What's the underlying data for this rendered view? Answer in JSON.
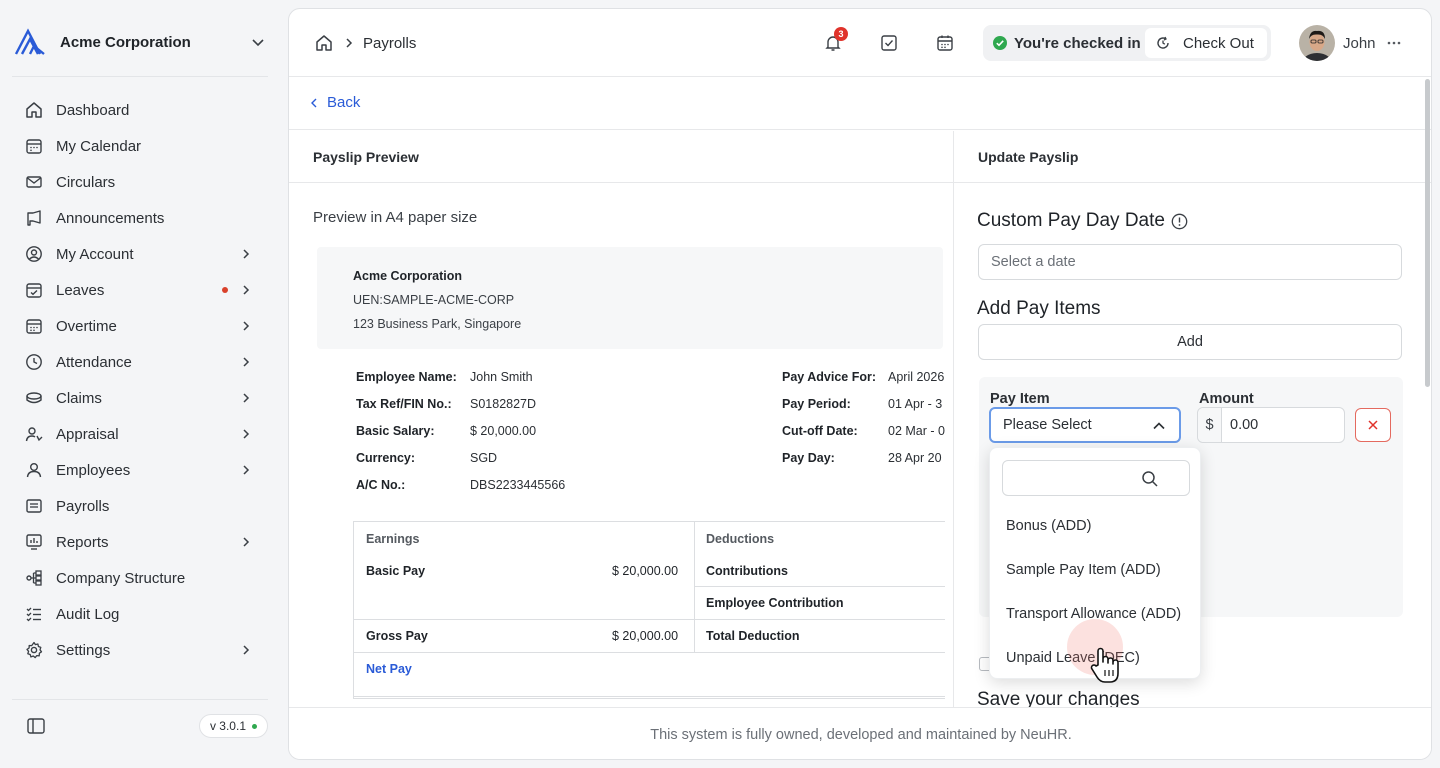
{
  "org": {
    "name": "Acme Corporation"
  },
  "nav": [
    {
      "label": "Dashboard",
      "icon": "home-icon",
      "chevron": false
    },
    {
      "label": "My Calendar",
      "icon": "calendar-icon",
      "chevron": false
    },
    {
      "label": "Circulars",
      "icon": "mail-icon",
      "chevron": false
    },
    {
      "label": "Announcements",
      "icon": "megaphone-icon",
      "chevron": false
    },
    {
      "label": "My Account",
      "icon": "user-circle-icon",
      "chevron": true
    },
    {
      "label": "Leaves",
      "icon": "calendar-check-icon",
      "chevron": true,
      "dot": true
    },
    {
      "label": "Overtime",
      "icon": "calendar-clock-icon",
      "chevron": true
    },
    {
      "label": "Attendance",
      "icon": "clock-icon",
      "chevron": true
    },
    {
      "label": "Claims",
      "icon": "coins-icon",
      "chevron": true
    },
    {
      "label": "Appraisal",
      "icon": "user-star-icon",
      "chevron": true
    },
    {
      "label": "Employees",
      "icon": "user-icon",
      "chevron": true
    },
    {
      "label": "Payrolls",
      "icon": "receipt-icon",
      "chevron": false
    },
    {
      "label": "Reports",
      "icon": "chart-icon",
      "chevron": true
    },
    {
      "label": "Company Structure",
      "icon": "org-chart-icon",
      "chevron": false
    },
    {
      "label": "Audit Log",
      "icon": "list-check-icon",
      "chevron": false
    },
    {
      "label": "Settings",
      "icon": "gear-icon",
      "chevron": true
    }
  ],
  "version": "v 3.0.1",
  "breadcrumb": {
    "current": "Payrolls"
  },
  "notifications": {
    "count": "3"
  },
  "checkin": {
    "status": "You're checked in",
    "button": "Check Out"
  },
  "user": {
    "name": "John"
  },
  "back_label": "Back",
  "preview": {
    "title": "Payslip Preview",
    "subtitle": "Preview in A4 paper size",
    "company": "Acme Corporation",
    "uen": "UEN:SAMPLE-ACME-CORP",
    "address": "123 Business Park, Singapore",
    "left_info": [
      {
        "k": "Employee Name:",
        "v": "John Smith"
      },
      {
        "k": "Tax Ref/FIN No.:",
        "v": "S0182827D"
      },
      {
        "k": "Basic Salary:",
        "v": "$ 20,000.00"
      },
      {
        "k": "Currency:",
        "v": "SGD"
      },
      {
        "k": "A/C No.:",
        "v": "DBS2233445566"
      }
    ],
    "right_info": [
      {
        "k": "Pay Advice For:",
        "v": "April 2026"
      },
      {
        "k": "Pay Period:",
        "v": "01 Apr - 3"
      },
      {
        "k": "Cut-off Date:",
        "v": "02 Mar - 0"
      },
      {
        "k": "Pay Day:",
        "v": "28 Apr 20"
      }
    ],
    "table": {
      "earnings_header": "Earnings",
      "deductions_header": "Deductions",
      "basic_pay_label": "Basic Pay",
      "basic_pay_value": "$ 20,000.00",
      "contributions_label": "Contributions",
      "employee_contribution_label": "Employee Contribution",
      "gross_pay_label": "Gross Pay",
      "gross_pay_value": "$ 20,000.00",
      "total_deduction_label": "Total Deduction",
      "net_pay_label": "Net Pay"
    }
  },
  "update": {
    "title": "Update Payslip",
    "custom_date_label": "Custom Pay Day Date",
    "date_placeholder": "Select a date",
    "add_items_label": "Add Pay Items",
    "add_button": "Add",
    "pay_item_label": "Pay Item",
    "amount_label": "Amount",
    "select_value": "Please Select",
    "currency_symbol": "$",
    "amount_value": "0.00",
    "dropdown_options": [
      "Bonus (ADD)",
      "Sample Pay Item (ADD)",
      "Transport Allowance (ADD)",
      "Unpaid Leave (DEC)"
    ],
    "save_label": "Save your changes"
  },
  "footer": "This system is fully owned, developed and maintained by NeuHR.",
  "colors": {
    "accent": "#2a5bd7",
    "danger": "#e0332b",
    "success": "#2fa84f"
  }
}
